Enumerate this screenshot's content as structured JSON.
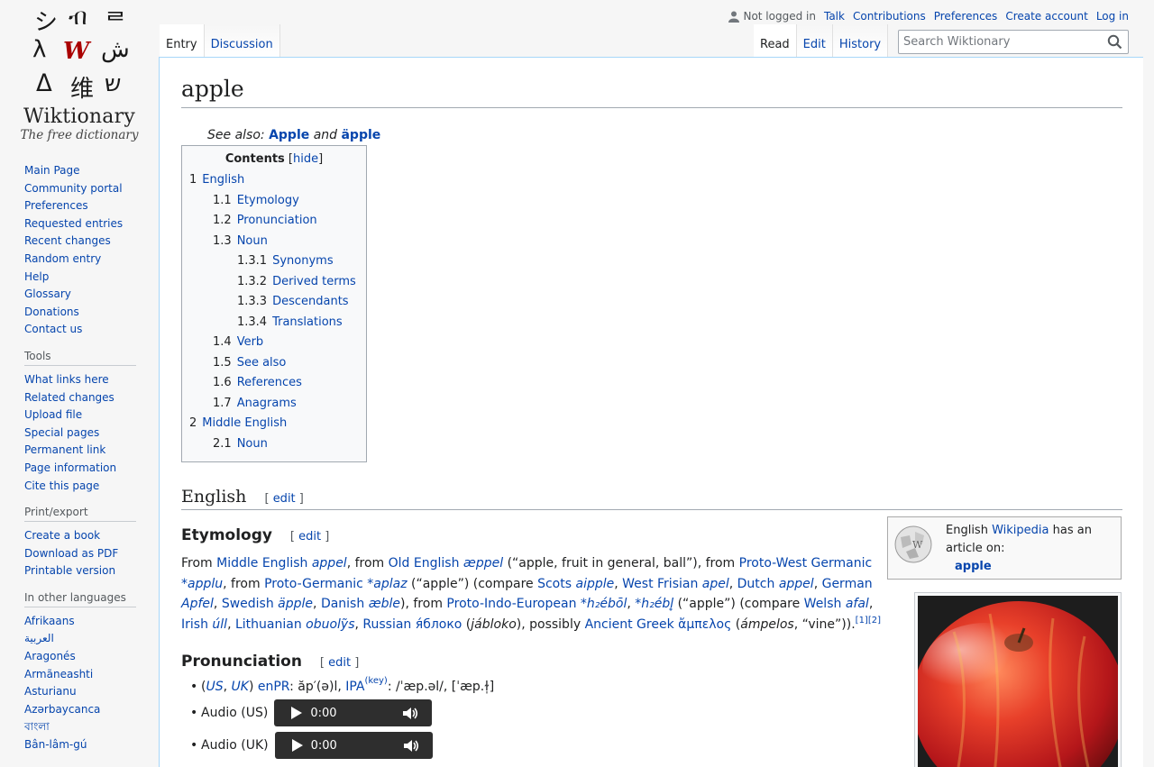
{
  "logo": {
    "wordmark": "Wiktionary",
    "tagline": "The free dictionary",
    "glyphs": [
      "シ",
      "ብ",
      "ᄅ",
      "λ",
      "W",
      "ش",
      "ᐃ",
      "维",
      "ש"
    ]
  },
  "sidebar": {
    "nav": [
      "Main Page",
      "Community portal",
      "Preferences",
      "Requested entries",
      "Recent changes",
      "Random entry",
      "Help",
      "Glossary",
      "Donations",
      "Contact us"
    ],
    "tools_title": "Tools",
    "tools": [
      "What links here",
      "Related changes",
      "Upload file",
      "Special pages",
      "Permanent link",
      "Page information",
      "Cite this page"
    ],
    "print_title": "Print/export",
    "print": [
      "Create a book",
      "Download as PDF",
      "Printable version"
    ],
    "lang_title": "In other languages",
    "langs": [
      "Afrikaans",
      "العربية",
      "Aragonés",
      "Armãneashti",
      "Asturianu",
      "Azərbaycanca",
      "বাংলা",
      "Bân-lâm-gú"
    ]
  },
  "personal": {
    "not_logged": "Not logged in",
    "talk": "Talk",
    "contributions": "Contributions",
    "preferences": "Preferences",
    "create": "Create account",
    "login": "Log in"
  },
  "tabs": {
    "entry": "Entry",
    "discussion": "Discussion",
    "read": "Read",
    "edit": "Edit",
    "history": "History"
  },
  "search": {
    "placeholder": "Search Wiktionary"
  },
  "page": {
    "title": "apple",
    "seealso_prefix": "See also:",
    "seealso_1": "Apple",
    "seealso_and": "and",
    "seealso_2": "äpple"
  },
  "toc": {
    "title": "Contents",
    "hide": "hide",
    "items": [
      {
        "n": "1",
        "t": "English",
        "lvl": 1
      },
      {
        "n": "1.1",
        "t": "Etymology",
        "lvl": 2
      },
      {
        "n": "1.2",
        "t": "Pronunciation",
        "lvl": 2
      },
      {
        "n": "1.3",
        "t": "Noun",
        "lvl": 2
      },
      {
        "n": "1.3.1",
        "t": "Synonyms",
        "lvl": 3
      },
      {
        "n": "1.3.2",
        "t": "Derived terms",
        "lvl": 3
      },
      {
        "n": "1.3.3",
        "t": "Descendants",
        "lvl": 3
      },
      {
        "n": "1.3.4",
        "t": "Translations",
        "lvl": 3
      },
      {
        "n": "1.4",
        "t": "Verb",
        "lvl": 2
      },
      {
        "n": "1.5",
        "t": "See also",
        "lvl": 2
      },
      {
        "n": "1.6",
        "t": "References",
        "lvl": 2
      },
      {
        "n": "1.7",
        "t": "Anagrams",
        "lvl": 2
      },
      {
        "n": "2",
        "t": "Middle English",
        "lvl": 1
      },
      {
        "n": "2.1",
        "t": "Noun",
        "lvl": 2
      }
    ]
  },
  "sections": {
    "english": "English",
    "etymology": "Etymology",
    "pronunciation": "Pronunciation",
    "edit": "edit"
  },
  "wikipedia_box": {
    "prefix": "English",
    "link": "Wikipedia",
    "suffix": "has an article on:",
    "article": "apple"
  },
  "etymology": {
    "t01": "From ",
    "l01": "Middle English",
    "t02": " ",
    "l02": "appel",
    "t03": ", from ",
    "l03": "Old English",
    "t04": " ",
    "l04": "æppel",
    "t05": " (“apple, fruit in general, ball”), from ",
    "l05": "Proto-West Germanic",
    "t06": " ",
    "l06": "*applu",
    "t07": ", from ",
    "l07": "Proto-Germanic",
    "t08": " ",
    "l08": "*aplaz",
    "t09": " (“apple”) (compare ",
    "l09": "Scots",
    "t10": " ",
    "l10": "aipple",
    "t11": ", ",
    "l11": "West Frisian",
    "t12": " ",
    "l12": "apel",
    "t13": ", ",
    "l13": "Dutch",
    "t14": " ",
    "l14": "appel",
    "t15": ", ",
    "l15": "German",
    "t16": " ",
    "l16": "Apfel",
    "t17": ", ",
    "l17": "Swedish",
    "t18": " ",
    "l18": "äpple",
    "t19": ", ",
    "l19": "Danish",
    "t20": " ",
    "l20": "æble",
    "t21": "), from ",
    "l21": "Proto-Indo-European",
    "t22": " ",
    "l22": "*h₂ébōl",
    "t23": ", ",
    "l23": "*h₂ébl̥",
    "t24": " (“apple”) (compare ",
    "l24": "Welsh",
    "t25": " ",
    "l25": "afal",
    "t26": ", ",
    "l26": "Irish",
    "t27": " ",
    "l27": "úll",
    "t28": ", ",
    "l28": "Lithuanian",
    "t29": " ",
    "l29": "obuolỹs",
    "t30": ", ",
    "l30": "Russian",
    "t31": " ",
    "l31": "я́блоко",
    "t32": " (",
    "i32": "jábloko",
    "t33": "), possibly ",
    "l33": "Ancient Greek",
    "t34": " ",
    "l34": "ἄμπελος",
    "t35": " (",
    "i35": "ámpelos",
    "t36": ", “vine”)).",
    "ref1": "[1]",
    "ref2": "[2]"
  },
  "pronunciation": {
    "paren_open": "(",
    "us": "US",
    "comma": ", ",
    "uk": "UK",
    "paren_close": ") ",
    "enpr": "enPR",
    "enpr_val": ": ăp′(ə)l, ",
    "ipa": "IPA",
    "key": "(key)",
    "ipa_val": ": /ˈæp.əl/, [ˈæp.ɫ̩]",
    "audio_us": "Audio (US)",
    "audio_uk": "Audio (UK)",
    "time": "0:00"
  },
  "colors": {
    "link": "#0645ad",
    "border": "#a7d7f9",
    "red_link": "#ba0000"
  }
}
